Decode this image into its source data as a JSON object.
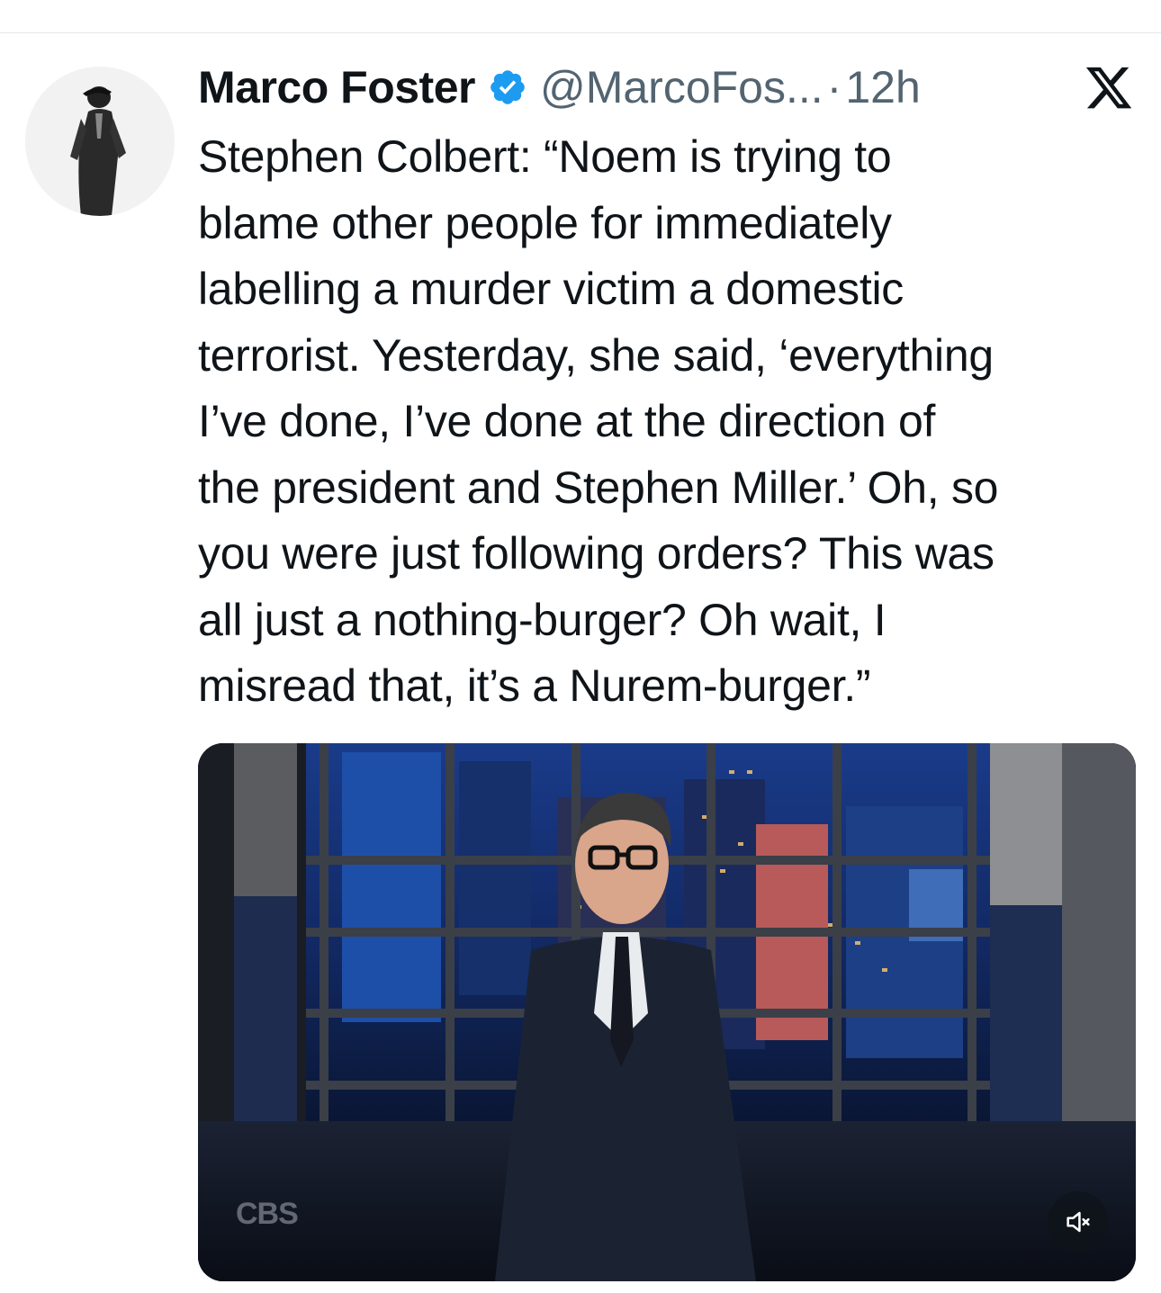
{
  "tweet": {
    "display_name": "Marco Foster",
    "verified": true,
    "handle": "@MarcoFos...",
    "separator": "·",
    "time": "12h",
    "text": "Stephen Colbert: “Noem is trying to\nblame other people for immediately\nlabelling a murder victim a domestic\nterrorist. Yesterday, she said, ‘everything\nI’ve done, I’ve done at the direction of\nthe president and Stephen Miller.’ Oh, so\nyou were just following orders? This was\nall just a nothing-burger? Oh wait, I\nmisread that, it’s a Nurem-burger.”"
  },
  "media": {
    "type": "video",
    "watermark": "CBS",
    "muted": true
  },
  "icons": {
    "verified": "verified-badge-icon",
    "platform": "x-logo-icon",
    "mute": "speaker-muted-icon"
  },
  "colors": {
    "verified_blue": "#1d9bf0",
    "secondary_text": "#536471",
    "primary_text": "#0f1419"
  }
}
